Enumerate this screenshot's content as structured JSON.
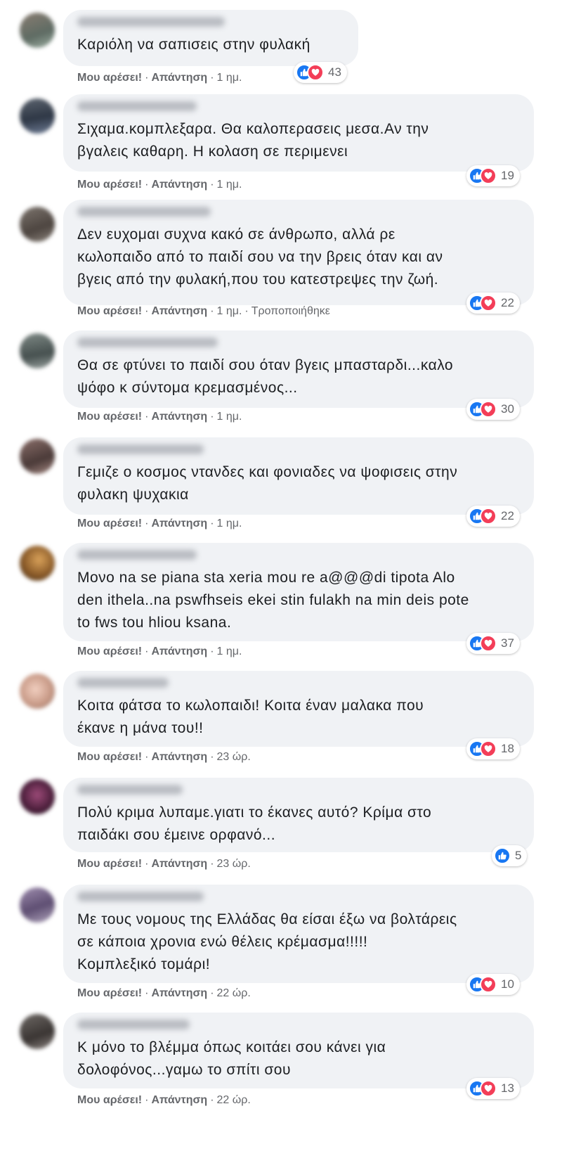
{
  "labels": {
    "like": "Μου αρέσει!",
    "reply": "Απάντηση",
    "separator": "·"
  },
  "colors": {
    "bubble": "#f0f2f5",
    "like_blue": "#1877f2",
    "love_red": "#f33e58",
    "meta_gray": "#65676b"
  },
  "comments": [
    {
      "text": "Καριόλη να σαπισεις στην φυλακή",
      "time": "1 ημ.",
      "reactions": "43",
      "icons": [
        "like-icon",
        "love-icon"
      ],
      "edited": ""
    },
    {
      "text": "Σιχαμα.κομπλεξαρα. Θα καλοπερασεις μεσα.Αν την\nβγαλεις καθαρη. Η κολαση σε περιμενει",
      "time": "1 ημ.",
      "reactions": "19",
      "icons": [
        "like-icon",
        "love-icon"
      ],
      "edited": ""
    },
    {
      "text": "Δεν ευχομαι συχνα κακό σε άνθρωπο, αλλά ρε\nκωλοπαιδο από το παιδί σου να την βρεις όταν και αν\nβγεις από την φυλακή,που του κατεστρεψες την ζωή.",
      "time": "1 ημ.",
      "reactions": "22",
      "icons": [
        "like-icon",
        "love-icon"
      ],
      "edited": "Τροποποιήθηκε"
    },
    {
      "text": "Θα σε φτύνει το παιδί σου όταν βγεις μπασταρδι...καλο\nψόφο κ σύντομα κρεμασμένος...",
      "time": "1 ημ.",
      "reactions": "30",
      "icons": [
        "like-icon",
        "love-icon"
      ],
      "edited": ""
    },
    {
      "text": "Γεμιζε ο κοσμος ντανδες και φονιαδες να ψοφισεις στην\nφυλακη ψυχακια",
      "time": "1 ημ.",
      "reactions": "22",
      "icons": [
        "like-icon",
        "love-icon"
      ],
      "edited": ""
    },
    {
      "text": "Μονο na se piana sta xeria mou re a@@@di tipota Alo\nden ithela..na pswfhseis ekei stin fulakh na min deis pote\nto fws tou hliou ksana.",
      "time": "1 ημ.",
      "reactions": "37",
      "icons": [
        "like-icon",
        "love-icon"
      ],
      "edited": ""
    },
    {
      "text": "Κοιτα φάτσα το κωλοπαιδι! Κοιτα έναν μαλακα που\nέκανε η μάνα του!!",
      "time": "23 ώρ.",
      "reactions": "18",
      "icons": [
        "like-icon",
        "love-icon"
      ],
      "edited": ""
    },
    {
      "text": "Πολύ κριμα λυπαμε.γιατι το έκανες αυτό? Κρίμα στο\nπαιδάκι σου έμεινε ορφανό...",
      "time": "23 ώρ.",
      "reactions": "5",
      "icons": [
        "like-icon"
      ],
      "edited": ""
    },
    {
      "text": "Με τους νομους της Ελλάδας θα είσαι έξω να βολτάρεις\nσε κάποια χρονια ενώ θέλεις κρέμασμα!!!!!\nΚομπλεξικό τομάρι!",
      "time": "22 ώρ.",
      "reactions": "10",
      "icons": [
        "like-icon",
        "love-icon"
      ],
      "edited": ""
    },
    {
      "text": "Κ μόνο το βλέμμα όπως κοιτάει σου κάνει για\nδολοφόνος...γαμω το σπίτι σου",
      "time": "22 ώρ.",
      "reactions": "13",
      "icons": [
        "like-icon",
        "love-icon"
      ],
      "edited": ""
    }
  ]
}
